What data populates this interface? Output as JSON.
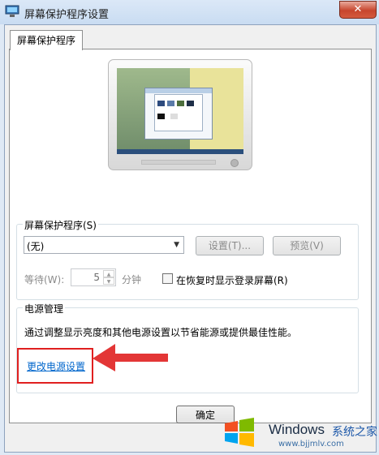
{
  "window": {
    "title": "屏幕保护程序设置",
    "close_glyph": "✕"
  },
  "tab": {
    "label": "屏幕保护程序"
  },
  "screensaver_group": {
    "title": "屏幕保护程序(S)",
    "selected": "(无)",
    "settings_button": "设置(T)...",
    "preview_button": "预览(V)",
    "wait_label": "等待(W):",
    "wait_value": "5",
    "minutes_label": "分钟",
    "resume_checkbox_label": "在恢复时显示登录屏幕(R)",
    "resume_checked": false
  },
  "power_group": {
    "title": "电源管理",
    "description": "通过调整显示亮度和其他电源设置以节省能源或提供最佳性能。",
    "link": "更改电源设置"
  },
  "footer": {
    "ok_button": "确定"
  },
  "watermark": {
    "brand": "Windows",
    "cn": "系统之家",
    "url": "www.bjjmlv.com"
  },
  "colors": {
    "link": "#0066cc",
    "annotation_red": "#e02020"
  }
}
